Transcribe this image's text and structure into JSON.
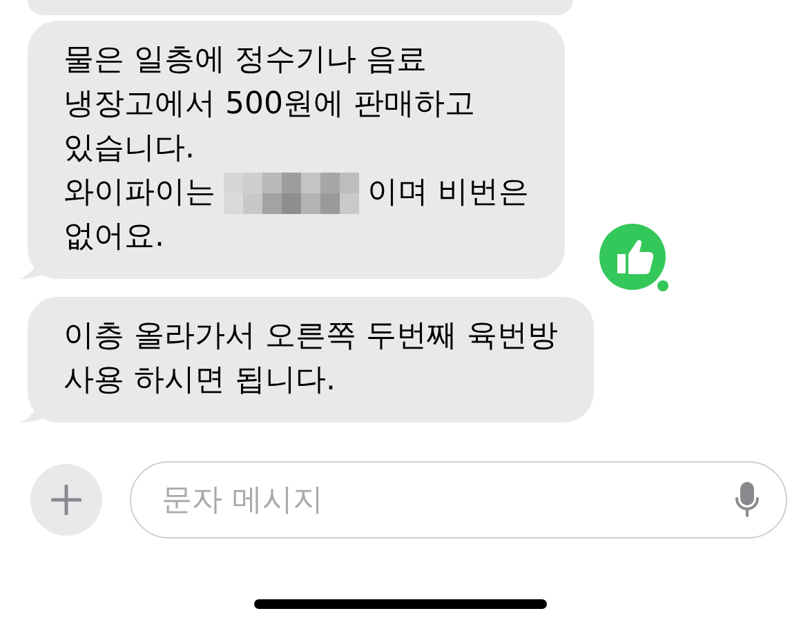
{
  "messages": [
    {
      "kind": "partial"
    },
    {
      "kind": "text",
      "lines": [
        [
          {
            "kind": "text",
            "text": "물은 일층에 정수기나 음료"
          }
        ],
        [
          {
            "kind": "text",
            "text": "냉장고에서 500원에 판매하고"
          }
        ],
        [
          {
            "kind": "text",
            "text": "있습니다."
          }
        ],
        [
          {
            "kind": "text",
            "text": "와이파이는"
          },
          {
            "kind": "redacted"
          },
          {
            "kind": "text",
            "text": "이며 비번은"
          }
        ],
        [
          {
            "kind": "text",
            "text": "없어요."
          }
        ]
      ],
      "reaction": {
        "kind": "thumbs-up",
        "color": "#34c759"
      }
    },
    {
      "kind": "text",
      "lines": [
        [
          {
            "kind": "text",
            "text": "이층 올라가서 오른쪽 두번째 육번방"
          }
        ],
        [
          {
            "kind": "text",
            "text": "사용 하시면 됩니다."
          }
        ]
      ]
    }
  ],
  "composer": {
    "placeholder": "문자 메시지"
  }
}
